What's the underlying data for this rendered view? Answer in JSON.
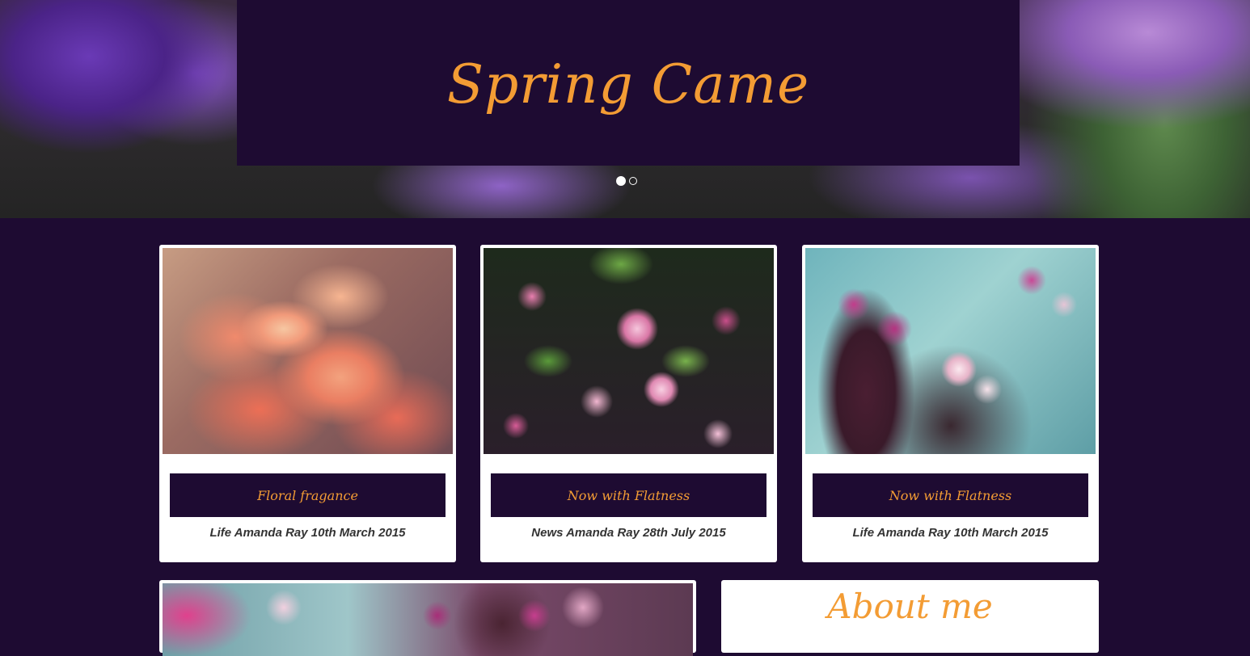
{
  "hero": {
    "title": "Spring Came",
    "slide_count": 2,
    "active_slide": 1
  },
  "cards": [
    {
      "button_label": "Floral fragance",
      "meta": "Life Amanda Ray 10th March 2015",
      "image": "orange-flowers"
    },
    {
      "button_label": "Now with Flatness",
      "meta": "News Amanda Ray 28th July 2015",
      "image": "pink-blossoms"
    },
    {
      "button_label": "Now with Flatness",
      "meta": "Life Amanda Ray 10th March 2015",
      "image": "cherry-blossoms"
    }
  ],
  "about": {
    "title": "About me"
  },
  "colors": {
    "background": "#1e0b32",
    "accent": "#f39c34",
    "card": "#ffffff"
  }
}
